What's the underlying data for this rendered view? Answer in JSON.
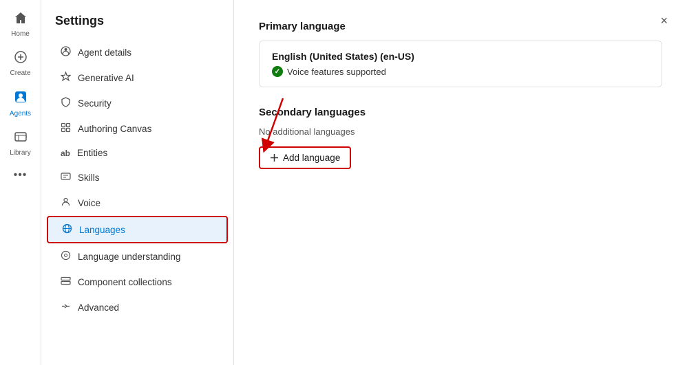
{
  "app": {
    "title": "Settings",
    "close_label": "×"
  },
  "nav": {
    "items": [
      {
        "id": "home",
        "label": "Home",
        "icon": "⊞",
        "active": false
      },
      {
        "id": "create",
        "label": "Create",
        "icon": "⊕",
        "active": false
      },
      {
        "id": "agents",
        "label": "Agents",
        "icon": "●",
        "active": true
      },
      {
        "id": "library",
        "label": "Library",
        "icon": "▦",
        "active": false
      },
      {
        "id": "more",
        "label": "...",
        "icon": "···",
        "active": false
      }
    ]
  },
  "settings_menu": {
    "items": [
      {
        "id": "agent-details",
        "label": "Agent details",
        "icon": "⚙"
      },
      {
        "id": "generative-ai",
        "label": "Generative AI",
        "icon": "✦"
      },
      {
        "id": "security",
        "label": "Security",
        "icon": "🔒"
      },
      {
        "id": "authoring-canvas",
        "label": "Authoring Canvas",
        "icon": "⊞"
      },
      {
        "id": "entities",
        "label": "Entities",
        "icon": "ab"
      },
      {
        "id": "skills",
        "label": "Skills",
        "icon": "◫"
      },
      {
        "id": "voice",
        "label": "Voice",
        "icon": "👤"
      },
      {
        "id": "languages",
        "label": "Languages",
        "icon": "☁",
        "active": true
      },
      {
        "id": "language-understanding",
        "label": "Language understanding",
        "icon": "⊙"
      },
      {
        "id": "component-collections",
        "label": "Component collections",
        "icon": "◻"
      },
      {
        "id": "advanced",
        "label": "Advanced",
        "icon": "⇌"
      }
    ]
  },
  "content": {
    "primary_language": {
      "section_title": "Primary language",
      "language_name": "English (United States) (en-US)",
      "support_text": "Voice features supported"
    },
    "secondary_languages": {
      "section_title": "Secondary languages",
      "no_languages_text": "No additional languages",
      "add_button_label": "Add language"
    }
  }
}
